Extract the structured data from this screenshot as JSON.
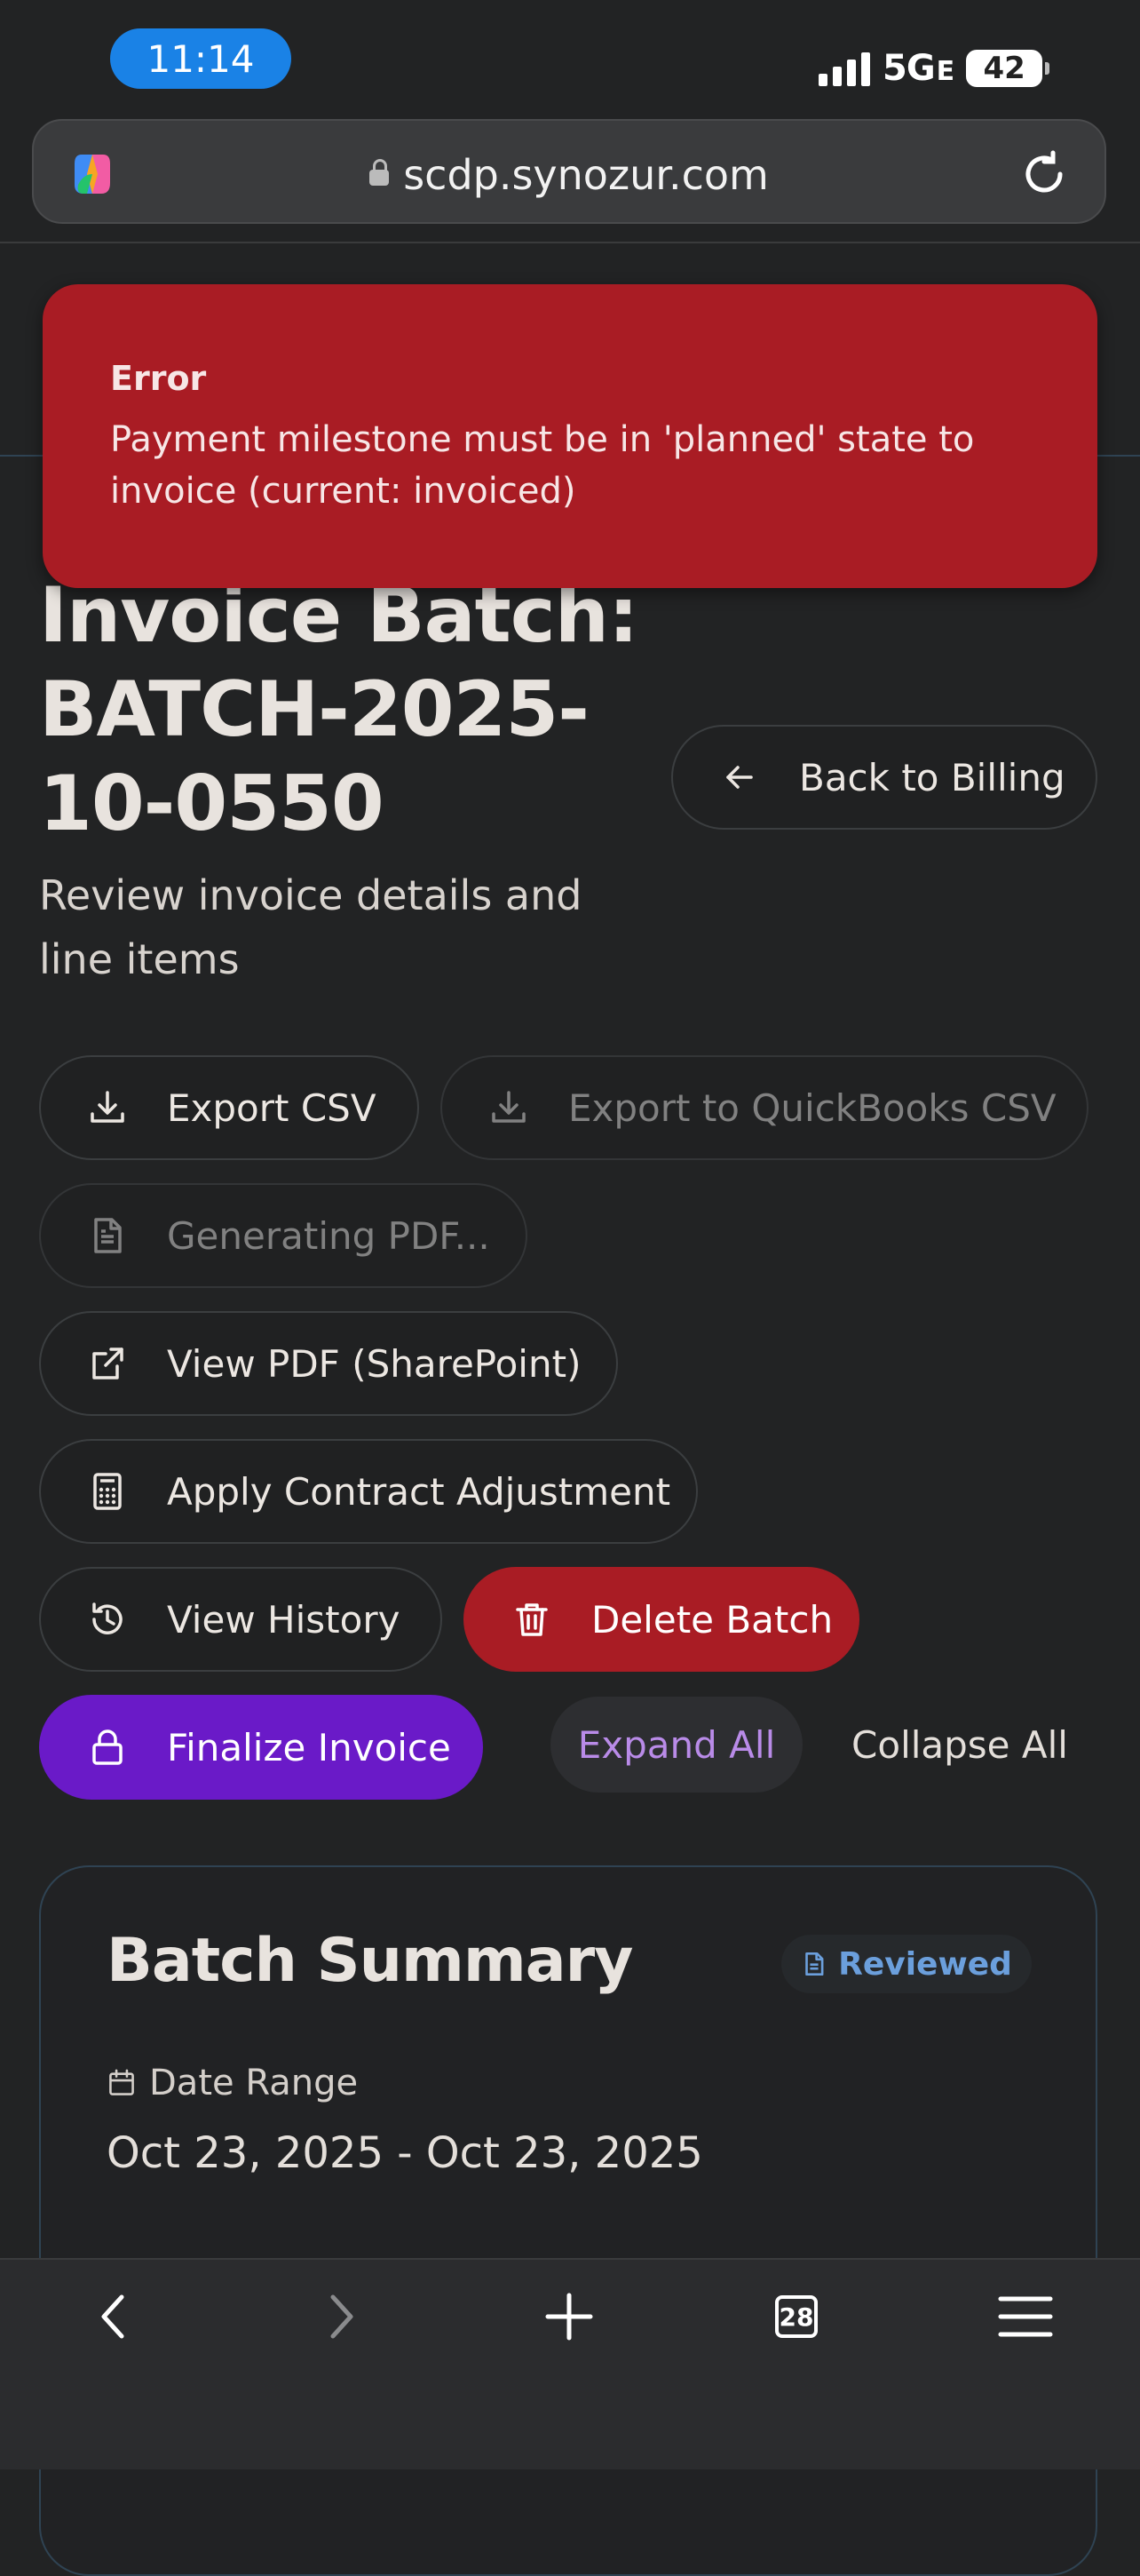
{
  "status_bar": {
    "time": "11:14",
    "network": "5G",
    "network_suffix": "E",
    "battery": "42"
  },
  "browser": {
    "url": "scdp.synozur.com",
    "tab_count": "28"
  },
  "toast": {
    "title": "Error",
    "message": "Payment milestone must be in 'planned' state to invoice (current: invoiced)"
  },
  "page": {
    "title": "Invoice Batch: BATCH-2025-10-0550",
    "subtitle": "Review invoice details and line items",
    "back_label": "Back to Billing"
  },
  "actions": {
    "export_csv": "Export CSV",
    "export_quickbooks": "Export to QuickBooks CSV",
    "generating_pdf": "Generating PDF...",
    "view_pdf": "View PDF (SharePoint)",
    "apply_adjustment": "Apply Contract Adjustment",
    "view_history": "View History",
    "delete_batch": "Delete Batch",
    "finalize_invoice": "Finalize Invoice",
    "expand_all": "Expand All",
    "collapse_all": "Collapse All"
  },
  "summary": {
    "title": "Batch Summary",
    "status": "Reviewed",
    "date_range_label": "Date Range",
    "date_range_value": "Oct 23, 2025 - Oct 23, 2025"
  },
  "colors": {
    "background": "#222324",
    "error": "#a91c24",
    "primary": "#6a1ac8",
    "link_purple": "#b98be8",
    "status_blue": "#6b9fdc"
  }
}
